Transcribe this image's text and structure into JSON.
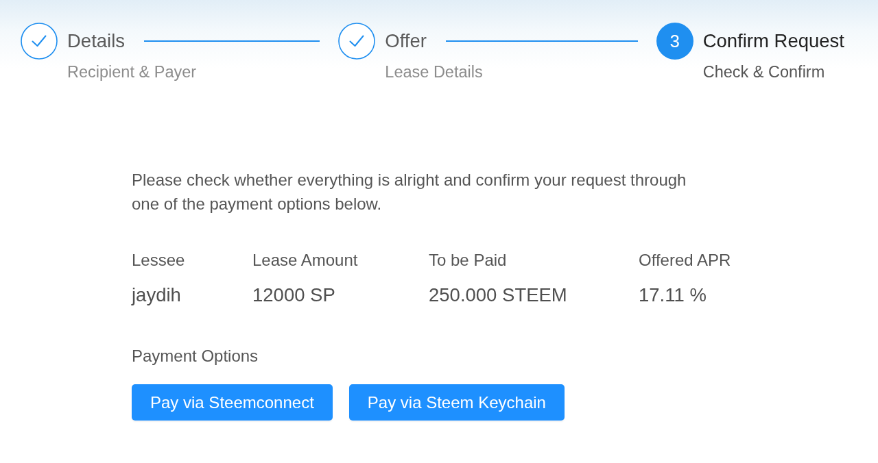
{
  "steps": [
    {
      "title": "Details",
      "description": "Recipient & Payer",
      "completed": true,
      "selected": false
    },
    {
      "title": "Offer",
      "description": "Lease Details",
      "completed": true,
      "selected": false
    },
    {
      "title": "Confirm Request",
      "description": "Check & Confirm",
      "completed": false,
      "selected": true,
      "number": "3"
    }
  ],
  "intro": "Please check whether everything is alright and confirm your request through one of the payment options below.",
  "summary": {
    "columns": [
      {
        "label": "Lessee",
        "value": "jaydih"
      },
      {
        "label": "Lease Amount",
        "value": "12000 SP"
      },
      {
        "label": "To be Paid",
        "value": "250.000 STEEM"
      },
      {
        "label": "Offered APR",
        "value": "17.11 %"
      }
    ]
  },
  "payment": {
    "heading": "Payment Options",
    "buttons": [
      "Pay via Steemconnect",
      "Pay via Steem Keychain"
    ]
  }
}
